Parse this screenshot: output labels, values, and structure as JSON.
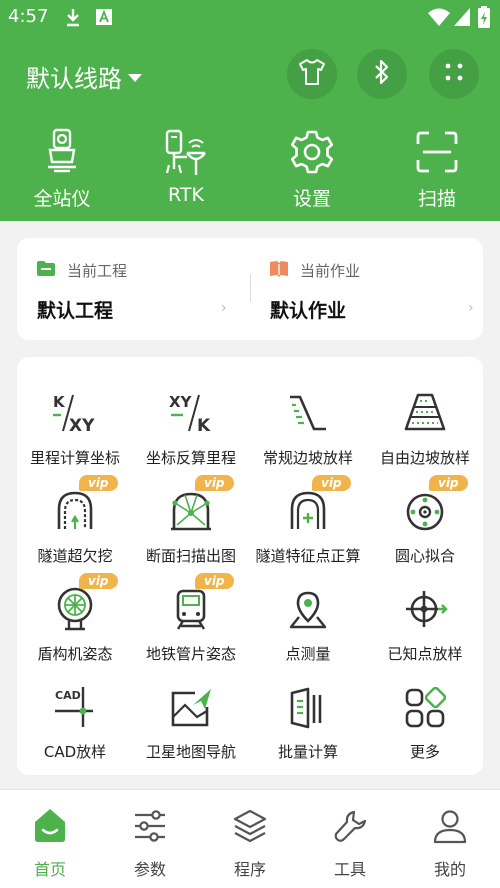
{
  "status_bar": {
    "time": "4:57",
    "icons": [
      "download-icon",
      "font-app-icon",
      "wifi-icon",
      "signal-icon",
      "battery-icon"
    ]
  },
  "header": {
    "route_title": "默认线路",
    "buttons": [
      "tshirt-icon",
      "bluetooth-icon",
      "grid-dots-icon"
    ]
  },
  "quick_actions": [
    {
      "label": "全站仪",
      "icon": "total-station-icon"
    },
    {
      "label": "RTK",
      "icon": "rtk-icon"
    },
    {
      "label": "设置",
      "icon": "gear-icon"
    },
    {
      "label": "扫描",
      "icon": "scan-icon"
    }
  ],
  "project_card": {
    "current_project_label": "当前工程",
    "current_project_value": "默认工程",
    "current_job_label": "当前作业",
    "current_job_value": "默认作业"
  },
  "tools": [
    {
      "label": "里程计算坐标",
      "icon": "k-xy-icon",
      "vip": ""
    },
    {
      "label": "坐标反算里程",
      "icon": "xy-k-icon",
      "vip": ""
    },
    {
      "label": "常规边坡放样",
      "icon": "slope-icon",
      "vip": ""
    },
    {
      "label": "自由边坡放样",
      "icon": "pyramid-slope-icon",
      "vip": ""
    },
    {
      "label": "隧道超欠挖",
      "icon": "tunnel-icon",
      "vip": "vip"
    },
    {
      "label": "断面扫描出图",
      "icon": "section-scan-icon",
      "vip": "vip"
    },
    {
      "label": "隧道特征点正算",
      "icon": "tunnel-feature-icon",
      "vip": "vip"
    },
    {
      "label": "圆心拟合",
      "icon": "circle-fit-icon",
      "vip": "vip"
    },
    {
      "label": "盾构机姿态",
      "icon": "shield-machine-icon",
      "vip": "vip"
    },
    {
      "label": "地铁管片姿态",
      "icon": "metro-train-icon",
      "vip": "vip"
    },
    {
      "label": "点测量",
      "icon": "map-pin-icon",
      "vip": ""
    },
    {
      "label": "已知点放样",
      "icon": "crosshair-icon",
      "vip": ""
    },
    {
      "label": "CAD放样",
      "icon": "cad-icon",
      "vip": ""
    },
    {
      "label": "卫星地图导航",
      "icon": "satellite-map-icon",
      "vip": ""
    },
    {
      "label": "批量计算",
      "icon": "batch-calc-icon",
      "vip": ""
    },
    {
      "label": "更多",
      "icon": "more-apps-icon",
      "vip": ""
    }
  ],
  "bottom_nav": [
    {
      "label": "首页",
      "icon": "home-icon",
      "active": true
    },
    {
      "label": "参数",
      "icon": "sliders-icon",
      "active": false
    },
    {
      "label": "程序",
      "icon": "layers-icon",
      "active": false
    },
    {
      "label": "工具",
      "icon": "wrench-icon",
      "active": false
    },
    {
      "label": "我的",
      "icon": "user-icon",
      "active": false
    }
  ],
  "colors": {
    "brand": "#4db24c",
    "vip": "#f0b44a",
    "folder": "#4db24c",
    "book": "#f08a5d"
  }
}
